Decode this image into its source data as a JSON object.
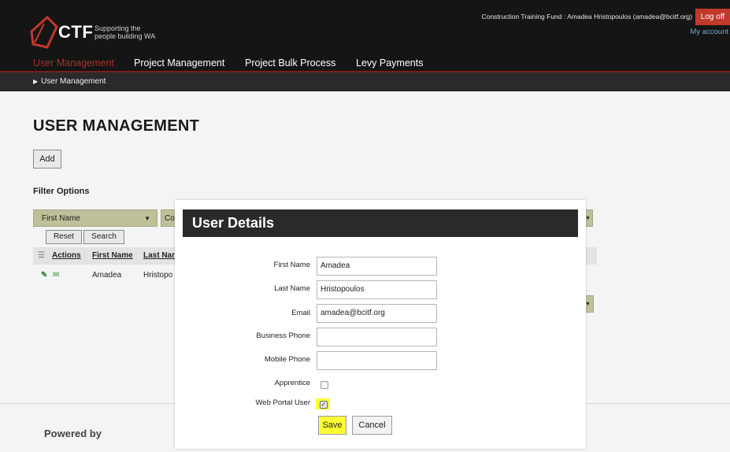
{
  "header": {
    "logo_text": "CTF",
    "logo_tagline_1": "Supporting the",
    "logo_tagline_2": "people building WA",
    "user_info": "Construction Training Fund : Amadea Hristopoulos (amadea@bcitf.org)",
    "logoff_label": "Log off",
    "my_account_label": "My account"
  },
  "nav": {
    "items": [
      {
        "label": "User Management",
        "active": true
      },
      {
        "label": "Project Management",
        "active": false
      },
      {
        "label": "Project Bulk Process",
        "active": false
      },
      {
        "label": "Levy Payments",
        "active": false
      }
    ]
  },
  "breadcrumb": {
    "current": "User Management"
  },
  "page": {
    "title": "USER MANAGEMENT",
    "add_label": "Add",
    "filter_title": "Filter Options",
    "filter_field": "First Name",
    "filter_field2": "Co",
    "reset_label": "Reset",
    "search_label": "Search",
    "grid": {
      "columns": [
        "Actions",
        "First Name",
        "Last Nar"
      ],
      "rows": [
        {
          "first_name": "Amadea",
          "last_name": "Hristopo"
        }
      ]
    },
    "powered_by": "Powered by"
  },
  "modal": {
    "title": "User Details",
    "fields": {
      "first_name": {
        "label": "First Name",
        "value": "Amadea"
      },
      "last_name": {
        "label": "Last Name",
        "value": "Hristopoulos"
      },
      "email": {
        "label": "Email",
        "value": "amadea@bcitf.org"
      },
      "business_phone": {
        "label": "Business Phone",
        "value": ""
      },
      "mobile_phone": {
        "label": "Mobile Phone",
        "value": ""
      },
      "apprentice": {
        "label": "Apprentice",
        "checked": false
      },
      "web_portal_user": {
        "label": "Web Portal User",
        "checked": true
      }
    },
    "save_label": "Save",
    "cancel_label": "Cancel"
  },
  "colors": {
    "header_bg": "#151515",
    "active_nav": "#a8322b",
    "logoff_bg": "#c0392b",
    "filter_select_bg": "#bfbf9a",
    "highlight": "#ffff33",
    "edit_icon": "#2f8a2f",
    "mail_icon": "#2f8a2f"
  }
}
